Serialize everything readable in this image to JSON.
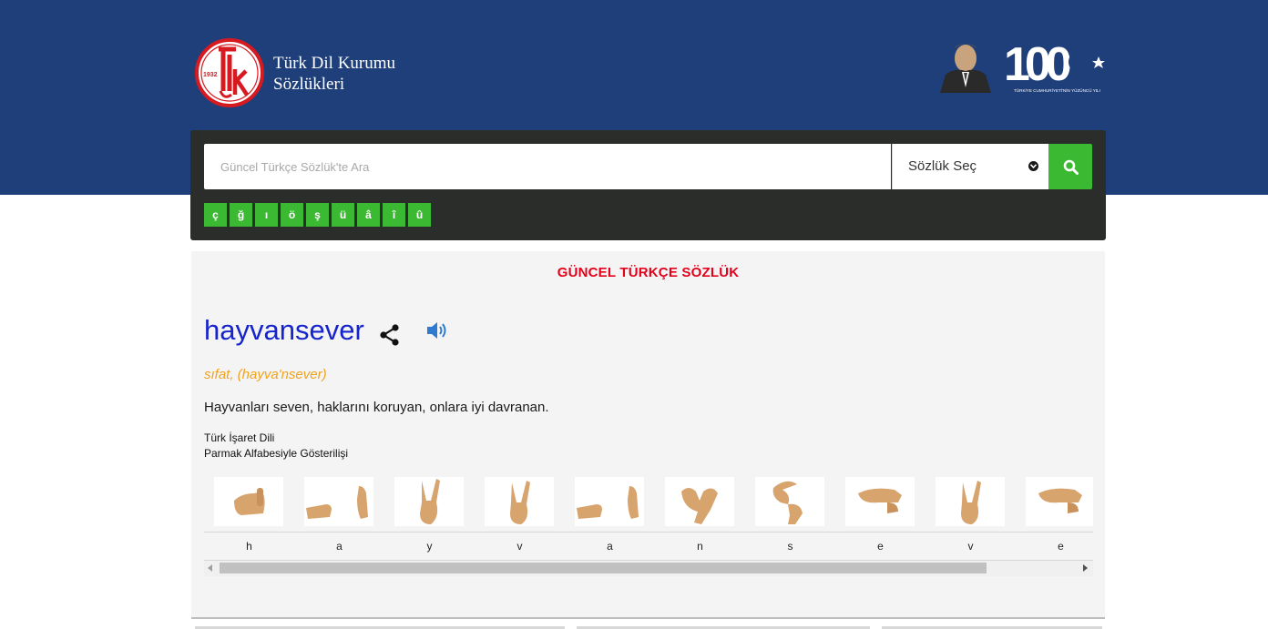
{
  "header": {
    "logo_year": "1932",
    "brand_line1": "Türk Dil Kurumu",
    "brand_line2": "Sözlükleri",
    "centennial_number": "100",
    "centennial_caption": "TÜRKİYE CUMHURİYETİ'NİN YÜZÜNCÜ YILI",
    "colors": {
      "band": "#1f3f7a"
    }
  },
  "search": {
    "placeholder": "Güncel Türkçe Sözlük'te Ara",
    "dictionary_select_label": "Sözlük Seç",
    "button_icon": "search-icon",
    "special_chars": [
      "ç",
      "ğ",
      "ı",
      "ö",
      "ş",
      "ü",
      "â",
      "î",
      "û"
    ],
    "colors": {
      "accent": "#3cb932",
      "panel": "#2b2d2b"
    }
  },
  "result": {
    "dictionary_title": "GÜNCEL TÜRKÇE SÖZLÜK",
    "word": "hayvansever",
    "share_icon": "share-icon",
    "audio_icon": "speaker-icon",
    "part_of_speech": "sıfat, (hayva'nsever)",
    "meaning": "Hayvanları seven, haklarını koruyan, onlara iyi davranan.",
    "sign_language_title": "Türk İşaret Dili",
    "sign_language_subtitle": "Parmak Alfabesiyle Gösterilişi",
    "fingerspelling": [
      "h",
      "a",
      "y",
      "v",
      "a",
      "n",
      "s",
      "e",
      "v",
      "e"
    ],
    "colors": {
      "title": "#e3001b",
      "word": "#1524cc",
      "pos": "#f2a21b"
    }
  }
}
